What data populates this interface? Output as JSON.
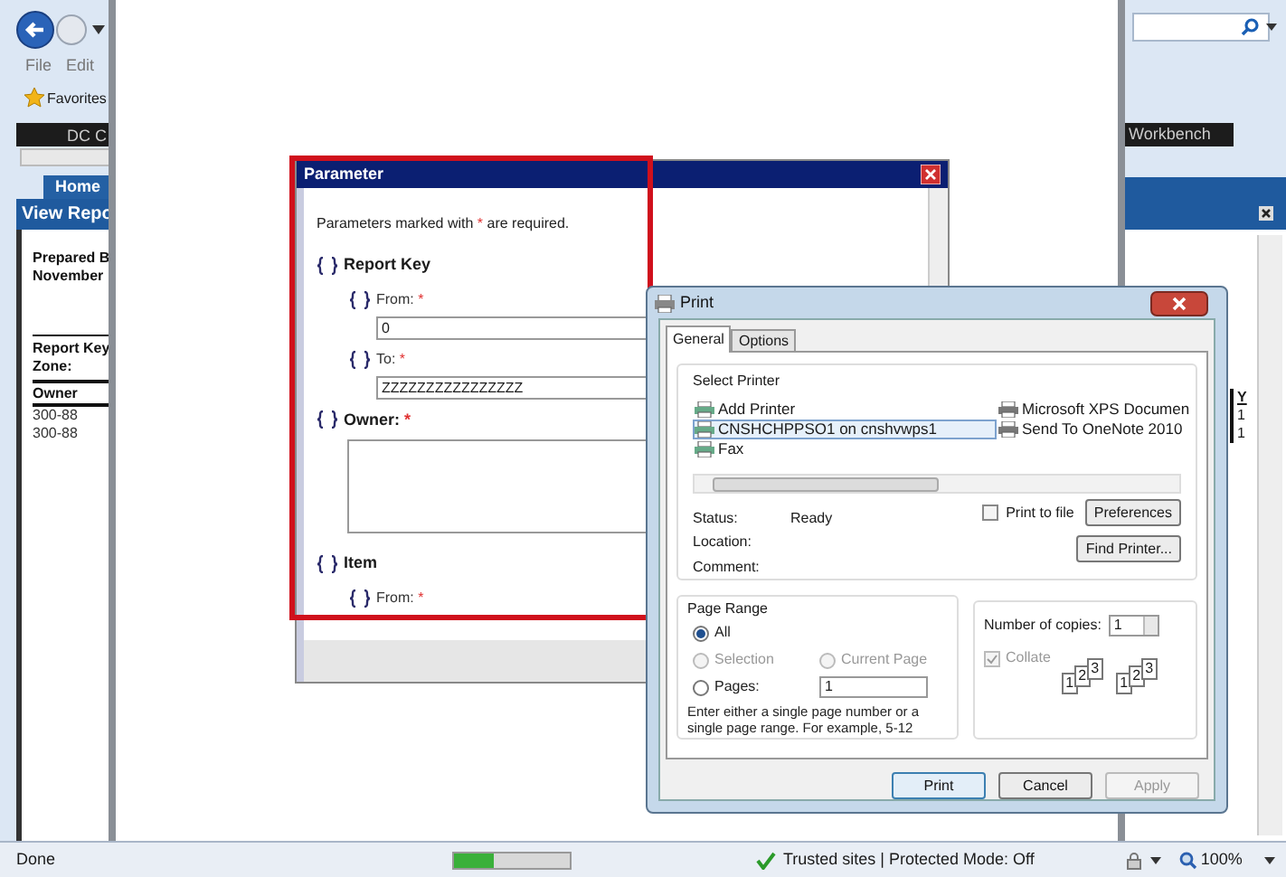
{
  "browser": {
    "menu": [
      "File",
      "Edit"
    ],
    "favorites": "Favorites",
    "nav_bar_left": "DC C",
    "nav_bar_right": "Workbench",
    "tab": {
      "label": "Home",
      "selected": true
    },
    "page_title": "View Repo",
    "page_lines": [
      {
        "text": "Prepared B",
        "kind": "bold"
      },
      {
        "text": "November",
        "kind": "bold"
      },
      {
        "text": "Report Key",
        "kind": "bold-gap"
      },
      {
        "text": "Zone:",
        "kind": "bold"
      },
      {
        "text": "Owner",
        "kind": "header"
      },
      {
        "text": "300-88",
        "kind": "plain"
      },
      {
        "text": "300-88",
        "kind": "plain"
      }
    ],
    "right_column": [
      "Y",
      "1",
      "1"
    ]
  },
  "parameter_dialog": {
    "title": "Parameter",
    "note": {
      "before": "Parameters marked with ",
      "mark": "*",
      "after": " are required."
    },
    "groups": [
      {
        "label": "Report Key",
        "kind": "group",
        "children": [
          {
            "label": "From:",
            "mark": "*",
            "value": "0"
          },
          {
            "label": "To:",
            "mark": "*",
            "value": "ZZZZZZZZZZZZZZZZ"
          }
        ]
      },
      {
        "label": "Owner:",
        "mark": "*",
        "kind": "textarea"
      },
      {
        "label": "Item",
        "kind": "group",
        "children": [
          {
            "label": "From:",
            "mark": "*"
          }
        ]
      }
    ]
  },
  "print_dialog": {
    "title": "Print",
    "tabs": [
      {
        "label": "General",
        "selected": true
      },
      {
        "label": "Options",
        "selected": false
      }
    ],
    "select_printer": {
      "legend": "Select Printer",
      "columns": [
        {
          "printers": [
            {
              "name": "Add Printer",
              "selected": false
            },
            {
              "name": "CNSHCHPPSO1 on cnshvwps1",
              "selected": true
            },
            {
              "name": "Fax",
              "selected": false
            }
          ]
        },
        {
          "printers": [
            {
              "name": "Microsoft XPS Documen",
              "selected": false
            },
            {
              "name": "Send To OneNote 2010",
              "selected": false
            }
          ]
        }
      ],
      "status_label": "Status:",
      "status_value": "Ready",
      "location_label": "Location:",
      "comment_label": "Comment:",
      "print_to_file": {
        "label": "Print to file",
        "checked": false
      },
      "preferences": "Preferences",
      "find_printer": "Find Printer..."
    },
    "page_range": {
      "legend": "Page Range",
      "options": [
        {
          "label": "All",
          "selected": true,
          "disabled": false
        },
        {
          "label": "Selection",
          "selected": false,
          "disabled": true
        },
        {
          "label": "Current Page",
          "selected": false,
          "disabled": true
        },
        {
          "label": "Pages:",
          "selected": false,
          "disabled": false
        }
      ],
      "pages_value": "1",
      "hint": "Enter either a single page number or a single page range.  For example, 5-12"
    },
    "copies": {
      "label": "Number of copies:",
      "value": "1",
      "collate": {
        "label": "Collate",
        "checked": true,
        "disabled": true
      },
      "collate_stacks": [
        [
          "1",
          "2",
          "3"
        ],
        [
          "1",
          "2",
          "3"
        ]
      ]
    },
    "buttons": [
      {
        "label": "Print",
        "kind": "default"
      },
      {
        "label": "Cancel",
        "kind": "normal"
      },
      {
        "label": "Apply",
        "kind": "disabled"
      }
    ]
  },
  "status_bar": {
    "text": "Done",
    "progress": {
      "level": 0.35
    },
    "zone": "Trusted sites | Protected Mode: Off",
    "zoom": "100%"
  }
}
